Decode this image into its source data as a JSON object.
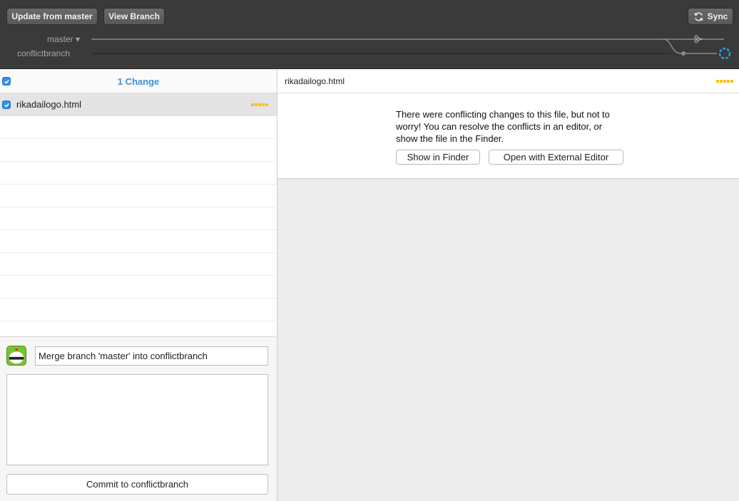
{
  "toolbar": {
    "update_label": "Update from master",
    "view_branch_label": "View Branch",
    "sync_label": "Sync"
  },
  "branches": {
    "master": "master ▾",
    "conflict": "conflictbranch"
  },
  "changes": {
    "title": "1 Change",
    "files": [
      {
        "name": "rikadailogo.html",
        "status": "conflict",
        "checked": true
      }
    ]
  },
  "commit": {
    "summary_value": "Merge branch 'master' into conflictbranch",
    "description_value": "",
    "commit_label": "Commit to conflictbranch"
  },
  "detail": {
    "file_name": "rikadailogo.html",
    "conflict_message": "There were conflicting changes to this file, but not to worry! You can resolve the conflicts in an editor, or show the file in the Finder.",
    "show_in_finder_label": "Show in Finder",
    "open_editor_label": "Open with External Editor"
  },
  "colors": {
    "toolbar_bg": "#3a3a3a",
    "accent_blue": "#3f8fd8",
    "conflict_yellow": "#f5c400",
    "graph_active": "#1ea0e6"
  },
  "icons": [
    "sync-icon",
    "checkbox-icon",
    "branch-graph",
    "avatar-icon"
  ]
}
